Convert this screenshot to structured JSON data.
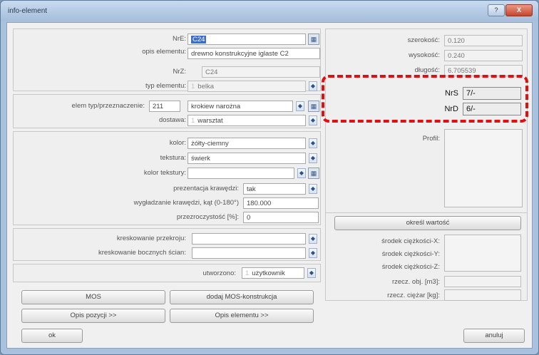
{
  "window": {
    "title": "info-element"
  },
  "left": {
    "nre_label": "NrE:",
    "nre_value": "C24",
    "opis_label": "opis elementu:",
    "opis_value": "drewno konstrukcyjne iglaste C2",
    "nrz_label": "NrZ:",
    "nrz_value": "C24",
    "typ_label": "typ elementu:",
    "typ_prefix": "1",
    "typ_value": "belka",
    "elemtyp_label": "elem typ/przeznaczenie:",
    "elemtyp_code": "211",
    "elemtyp_value": "krokiew narożna",
    "dostawa_label": "dostawa:",
    "dostawa_prefix": "1",
    "dostawa_value": "warsztat",
    "kolor_label": "kolor:",
    "kolor_value": "żółty-ciemny",
    "tekstura_label": "tekstura:",
    "tekstura_value": "świerk",
    "kolor_tekstury_label": "kolor tekstury:",
    "prezentacja_label": "prezentacja krawędzi:",
    "prezentacja_value": "tak",
    "wygladzanie_label": "wygładzanie krawędzi, kąt (0-180°)",
    "wygladzanie_value": "180.000",
    "przezroczystosc_label": "przezroczystość [%]:",
    "przezroczystosc_value": "0",
    "kreskowanie_przekroju_label": "kreskowanie przekroju:",
    "kreskowanie_scian_label": "kreskowanie bocznych ścian:",
    "utworzono_label": "utworzono:",
    "utworzono_prefix": "1",
    "utworzono_value": "użytkownik"
  },
  "right": {
    "szerokosc_label": "szerokość:",
    "szerokosc_value": "0.120",
    "wysokosc_label": "wysokość:",
    "wysokosc_value": "0.240",
    "dlugosc_label": "długość:",
    "dlugosc_value": "6.705539",
    "nrs_label": "NrS",
    "nrs_value": "7/-",
    "nrd_label": "NrD",
    "nrd_value": "6/-",
    "profil_label": "Profil:",
    "okresl_label": "określ wartość",
    "sx_label": "środek ciężkości-X:",
    "sy_label": "środek ciężkości-Y:",
    "sz_label": "środek ciężkości-Z:",
    "obj_label": "rzecz. obj. [m3]:",
    "ciezar_label": "rzecz. ciężar [kg]:"
  },
  "buttons": {
    "mos": "MOS",
    "dodaj_mos": "dodaj MOS-konstrukcja",
    "opis_pozycji": "Opis pozycji >>",
    "opis_elementu": "Opis elementu >>",
    "ok": "ok",
    "anuluj": "anuluj"
  },
  "titlebar_buttons": {
    "help": "?",
    "close": "X"
  },
  "icons": {
    "dropdown": "◆",
    "picker": "▦"
  }
}
